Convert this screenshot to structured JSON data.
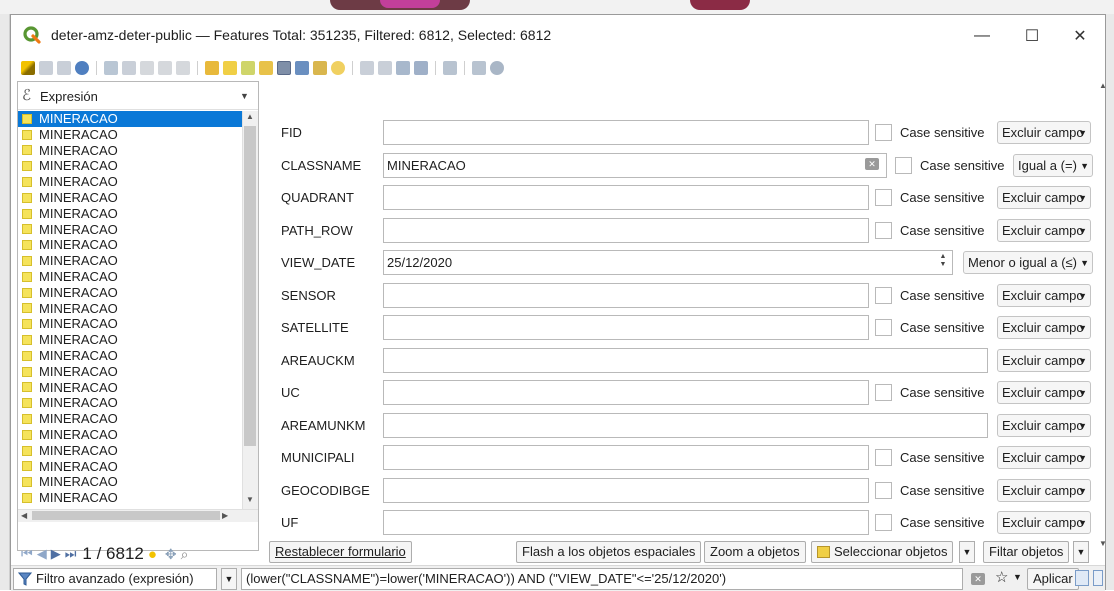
{
  "window": {
    "title": "deter-amz-deter-public — Features Total: 351235, Filtered: 6812, Selected: 6812",
    "minimize": "—",
    "maximize": "☐",
    "close": "✕"
  },
  "left_panel": {
    "header_label": "Expresión",
    "header_icon": "ℰ",
    "items": [
      "MINERACAO",
      "MINERACAO",
      "MINERACAO",
      "MINERACAO",
      "MINERACAO",
      "MINERACAO",
      "MINERACAO",
      "MINERACAO",
      "MINERACAO",
      "MINERACAO",
      "MINERACAO",
      "MINERACAO",
      "MINERACAO",
      "MINERACAO",
      "MINERACAO",
      "MINERACAO",
      "MINERACAO",
      "MINERACAO",
      "MINERACAO",
      "MINERACAO",
      "MINERACAO",
      "MINERACAO",
      "MINERACAO",
      "MINERACAO",
      "MINERACAO"
    ],
    "selected_index": 0
  },
  "nav": {
    "counter": "1 / 6812"
  },
  "fields": [
    {
      "label": "FID",
      "value": "",
      "case_sensitive": "Case sensitive",
      "operator": "Excluir campo"
    },
    {
      "label": "CLASSNAME",
      "value": "MINERACAO",
      "case_sensitive": "Case sensitive",
      "operator": "Igual a (=)"
    },
    {
      "label": "QUADRANT",
      "value": "",
      "case_sensitive": "Case sensitive",
      "operator": "Excluir campo"
    },
    {
      "label": "PATH_ROW",
      "value": "",
      "case_sensitive": "Case sensitive",
      "operator": "Excluir campo"
    },
    {
      "label": "VIEW_DATE",
      "value": "25/12/2020",
      "operator": "Menor o igual a (≤)"
    },
    {
      "label": "SENSOR",
      "value": "",
      "case_sensitive": "Case sensitive",
      "operator": "Excluir campo"
    },
    {
      "label": "SATELLITE",
      "value": "",
      "case_sensitive": "Case sensitive",
      "operator": "Excluir campo"
    },
    {
      "label": "AREAUCKM",
      "value": "",
      "operator": "Excluir campo"
    },
    {
      "label": "UC",
      "value": "",
      "case_sensitive": "Case sensitive",
      "operator": "Excluir campo"
    },
    {
      "label": "AREAMUNKM",
      "value": "",
      "operator": "Excluir campo"
    },
    {
      "label": "MUNICIPALI",
      "value": "",
      "case_sensitive": "Case sensitive",
      "operator": "Excluir campo"
    },
    {
      "label": "GEOCODIBGE",
      "value": "",
      "case_sensitive": "Case sensitive",
      "operator": "Excluir campo"
    },
    {
      "label": "UF",
      "value": "",
      "case_sensitive": "Case sensitive",
      "operator": "Excluir campo"
    }
  ],
  "buttons": {
    "reset": "Restablecer formulario",
    "flash": "Flash a los objetos espaciales",
    "zoom": "Zoom a objetos",
    "select": "Seleccionar objetos",
    "filter": "Filtar objetos"
  },
  "filter_bar": {
    "mode": "Filtro avanzado (expresión)",
    "expression": "(lower(\"CLASSNAME\")=lower('MINERACAO')) AND (\"VIEW_DATE\"<='25/12/2020')",
    "apply": "Aplicar"
  },
  "colors": {
    "selection": "#0a78d7",
    "feature_square": "#f5e35b",
    "qgis_green": "#589632"
  }
}
